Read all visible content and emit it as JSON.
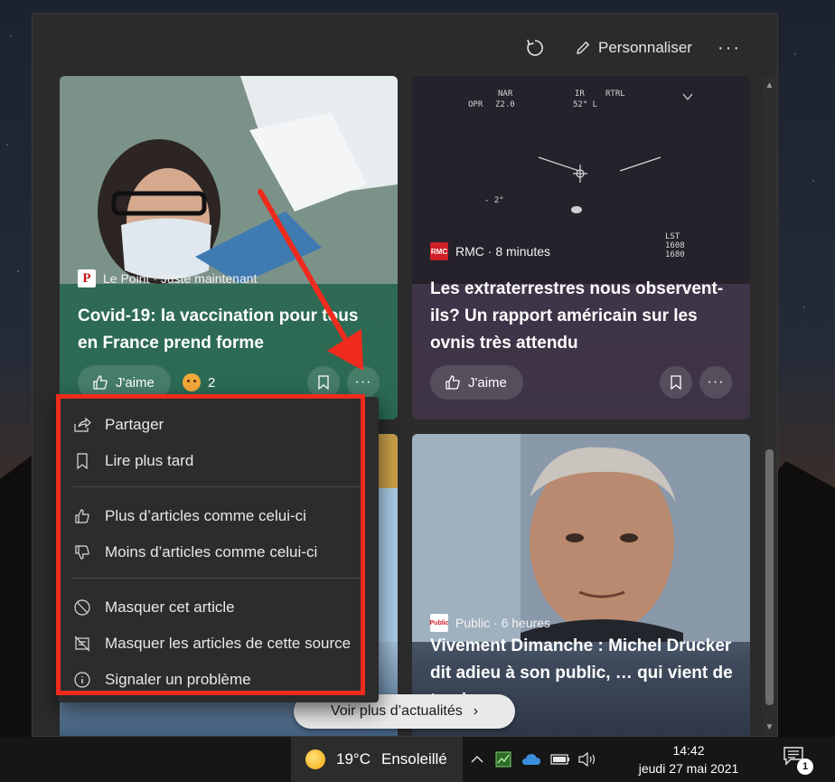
{
  "header": {
    "refresh_icon": "refresh-icon",
    "personalize_label": "Personnaliser",
    "more_label": "···"
  },
  "cards": [
    {
      "source": "Le Point · Juste maintenant",
      "logo_text": "P",
      "title": "Covid-19: la vaccination pour tous en France prend forme",
      "like_label": "J'aime",
      "reaction_count": "2"
    },
    {
      "source": "RMC · 8 minutes",
      "logo_text": "RMC",
      "title": "Les extraterrestres nous observent-ils? Un rapport américain sur les ovnis très attendu",
      "like_label": "J'aime"
    },
    {
      "source": "Public · 6 heures",
      "logo_text": "Public",
      "title": "Vivement Dimanche : Michel Drucker dit adieu à son public, … qui vient de tomber…"
    }
  ],
  "context_menu": {
    "items": [
      {
        "label": "Partager",
        "icon": "share-icon"
      },
      {
        "label": "Lire plus tard",
        "icon": "bookmark-icon"
      },
      {
        "label": "Plus d’articles comme celui-ci",
        "icon": "thumbs-up-icon"
      },
      {
        "label": "Moins d’articles comme celui-ci",
        "icon": "thumbs-down-icon"
      },
      {
        "label": "Masquer cet article",
        "icon": "block-icon"
      },
      {
        "label": "Masquer les articles de cette source",
        "icon": "hide-source-icon"
      },
      {
        "label": "Signaler un problème",
        "icon": "info-icon"
      }
    ]
  },
  "see_more_label": "Voir plus d’actualités",
  "taskbar": {
    "weather_temp": "19°C",
    "weather_condition": "Ensoleillé",
    "time": "14:42",
    "date": "jeudi 27 mai 2021",
    "notification_count": "1"
  },
  "colors": {
    "annotation_red": "#ee2b1d",
    "panel_bg": "#2b2b2b",
    "menu_bg": "#2c2c2c"
  }
}
